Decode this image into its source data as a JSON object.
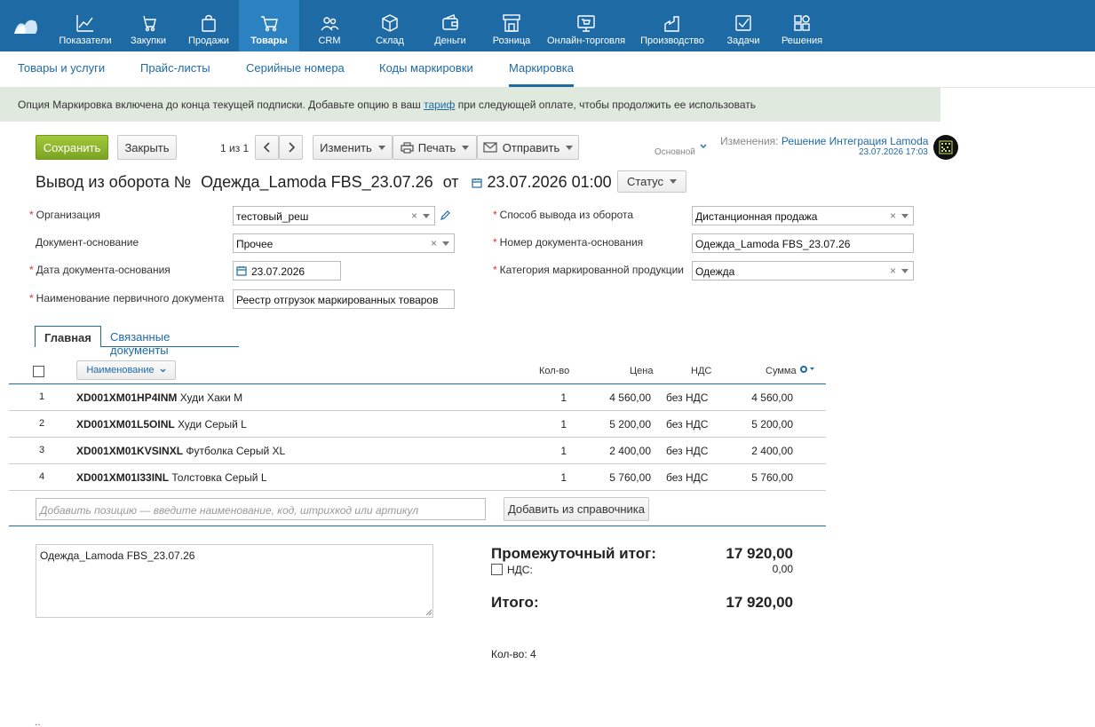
{
  "nav": {
    "items": [
      {
        "label": "Показатели",
        "icon": "chart-icon"
      },
      {
        "label": "Закупки",
        "icon": "cart-hand-icon"
      },
      {
        "label": "Продажи",
        "icon": "bag-icon"
      },
      {
        "label": "Товары",
        "icon": "cart-icon"
      },
      {
        "label": "CRM",
        "icon": "people-icon"
      },
      {
        "label": "Склад",
        "icon": "box-icon"
      },
      {
        "label": "Деньги",
        "icon": "wallet-icon"
      },
      {
        "label": "Розница",
        "icon": "store-icon"
      },
      {
        "label": "Онлайн-торговля",
        "icon": "online-store-icon"
      },
      {
        "label": "Производство",
        "icon": "factory-icon"
      },
      {
        "label": "Задачи",
        "icon": "checkbox-icon"
      },
      {
        "label": "Решения",
        "icon": "apps-icon"
      }
    ]
  },
  "subnav": {
    "items": [
      "Товары и услуги",
      "Прайс-листы",
      "Серийные номера",
      "Коды маркировки",
      "Маркировка"
    ]
  },
  "notice": {
    "before": "Опция Маркировка включена до конца текущей подписки. Добавьте опцию в ваш ",
    "link": "тариф",
    "after": " при следующей оплате, чтобы продолжить ее использовать"
  },
  "toolbar": {
    "save": "Сохранить",
    "close": "Закрыть",
    "pager": "1 из 1",
    "edit": "Изменить",
    "print": "Печать",
    "send": "Отправить",
    "base": "Основной",
    "changes_label": "Изменения:",
    "changes_author": "Решение Интеграция Lamoda",
    "changes_date": "23.07.2026 17:03"
  },
  "title": {
    "prefix": "Вывод из оборота №",
    "number": "Одежда_Lamoda FBS_23.07.26",
    "from": "от",
    "datetime": "23.07.2026 01:00",
    "status": "Статус"
  },
  "form": {
    "organization_label": "Организация",
    "organization_value": "тестовый_реш",
    "basis_label": "Документ-основание",
    "basis_value": "Прочее",
    "basis_date_label": "Дата документа-основания",
    "basis_date_value": "23.07.2026",
    "primary_doc_label": "Наименование первичного документа",
    "primary_doc_value": "Реестр отгрузок маркированных товаров",
    "withdraw_label": "Способ вывода из оборота",
    "withdraw_value": "Дистанционная продажа",
    "basis_number_label": "Номер документа-основания",
    "basis_number_value": "Одежда_Lamoda FBS_23.07.26",
    "category_label": "Категория маркированной продукции",
    "category_value": "Одежда"
  },
  "tabs": [
    "Главная",
    "Связанные документы"
  ],
  "table": {
    "headers": {
      "name": "Наименование",
      "qty": "Кол-во",
      "price": "Цена",
      "vat": "НДС",
      "sum": "Сумма"
    },
    "rows": [
      {
        "n": "1",
        "code": "XD001XM01HP4INM",
        "name": "Худи Хаки M",
        "qty": "1",
        "price": "4 560,00",
        "vat": "без НДС",
        "sum": "4 560,00"
      },
      {
        "n": "2",
        "code": "XD001XM01L5OINL",
        "name": "Худи Серый L",
        "qty": "1",
        "price": "5 200,00",
        "vat": "без НДС",
        "sum": "5 200,00"
      },
      {
        "n": "3",
        "code": "XD001XM01KVSINXL",
        "name": "Футболка Серый XL",
        "qty": "1",
        "price": "2 400,00",
        "vat": "без НДС",
        "sum": "2 400,00"
      },
      {
        "n": "4",
        "code": "XD001XM01I33INL",
        "name": "Толстовка Серый L",
        "qty": "1",
        "price": "5 760,00",
        "vat": "без НДС",
        "sum": "5 760,00"
      }
    ],
    "add_placeholder": "Добавить позицию — введите наименование, код, штрихкод или артикул",
    "add_from_catalog": "Добавить из справочника"
  },
  "comment": "Одежда_Lamoda FBS_23.07.26",
  "totals": {
    "subtotal_label": "Промежуточный итог:",
    "subtotal_value": "17 920,00",
    "vat_label": "НДС:",
    "vat_value": "0,00",
    "total_label": "Итого:",
    "total_value": "17 920,00",
    "qty_text": "Кол-во: 4"
  },
  "colors": {
    "brand": "#1e6aa5",
    "save": "#8bb42b",
    "notice_bg": "#dfe9dd"
  }
}
